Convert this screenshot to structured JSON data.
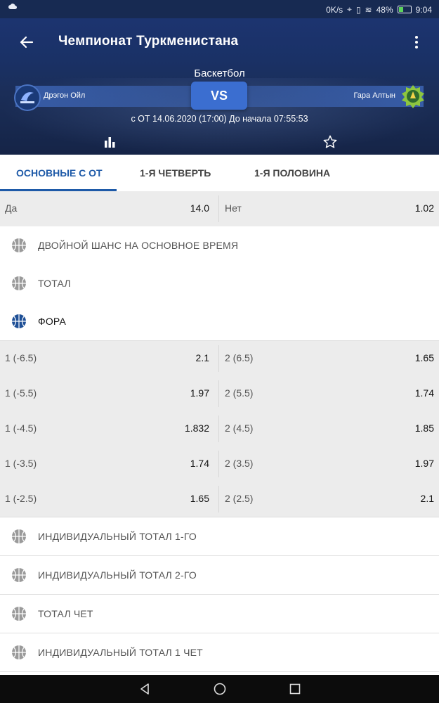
{
  "status": {
    "net_speed": "0K/s",
    "battery_percent": "48%",
    "battery_level": 0.48,
    "time": "9:04"
  },
  "header": {
    "title": "Чемпионат Туркменистана",
    "sport": "Баскетбол",
    "team1": "Дрэгон Ойл",
    "team2": "Гара Алтын",
    "vs_label": "VS",
    "datetime": "с ОТ 14.06.2020 (17:00)  До начала 07:55:53"
  },
  "tabs": [
    {
      "label": "ОСНОВНЫЕ С ОТ",
      "active": true
    },
    {
      "label": "1-Я ЧЕТВЕРТЬ",
      "active": false
    },
    {
      "label": "1-Я ПОЛОВИНА",
      "active": false
    }
  ],
  "yes_no": {
    "left_label": "Да",
    "left_value": "14.0",
    "right_label": "Нет",
    "right_value": "1.02"
  },
  "markets_top": [
    {
      "label": "ДВОЙНОЙ ШАНС НА ОСНОВНОЕ ВРЕМЯ"
    },
    {
      "label": "ТОТАЛ"
    },
    {
      "label": "ФОРА"
    }
  ],
  "handicap_rows": [
    {
      "left_label": "1 (-6.5)",
      "left_value": "2.1",
      "right_label": "2 (6.5)",
      "right_value": "1.65"
    },
    {
      "left_label": "1 (-5.5)",
      "left_value": "1.97",
      "right_label": "2 (5.5)",
      "right_value": "1.74"
    },
    {
      "left_label": "1 (-4.5)",
      "left_value": "1.832",
      "right_label": "2 (4.5)",
      "right_value": "1.85"
    },
    {
      "left_label": "1 (-3.5)",
      "left_value": "1.74",
      "right_label": "2 (3.5)",
      "right_value": "1.97"
    },
    {
      "left_label": "1 (-2.5)",
      "left_value": "1.65",
      "right_label": "2 (2.5)",
      "right_value": "2.1"
    }
  ],
  "markets_bottom": [
    {
      "label": "ИНДИВИДУАЛЬНЫЙ ТОТАЛ 1-ГО"
    },
    {
      "label": "ИНДИВИДУАЛЬНЫЙ ТОТАЛ 2-ГО"
    },
    {
      "label": "ТОТАЛ ЧЕТ"
    },
    {
      "label": "ИНДИВИДУАЛЬНЫЙ ТОТАЛ 1 ЧЕТ"
    }
  ],
  "colors": {
    "accent": "#1e5aa8",
    "header_bg": "#1b2e58",
    "vs_button": "#3b6ed0"
  }
}
